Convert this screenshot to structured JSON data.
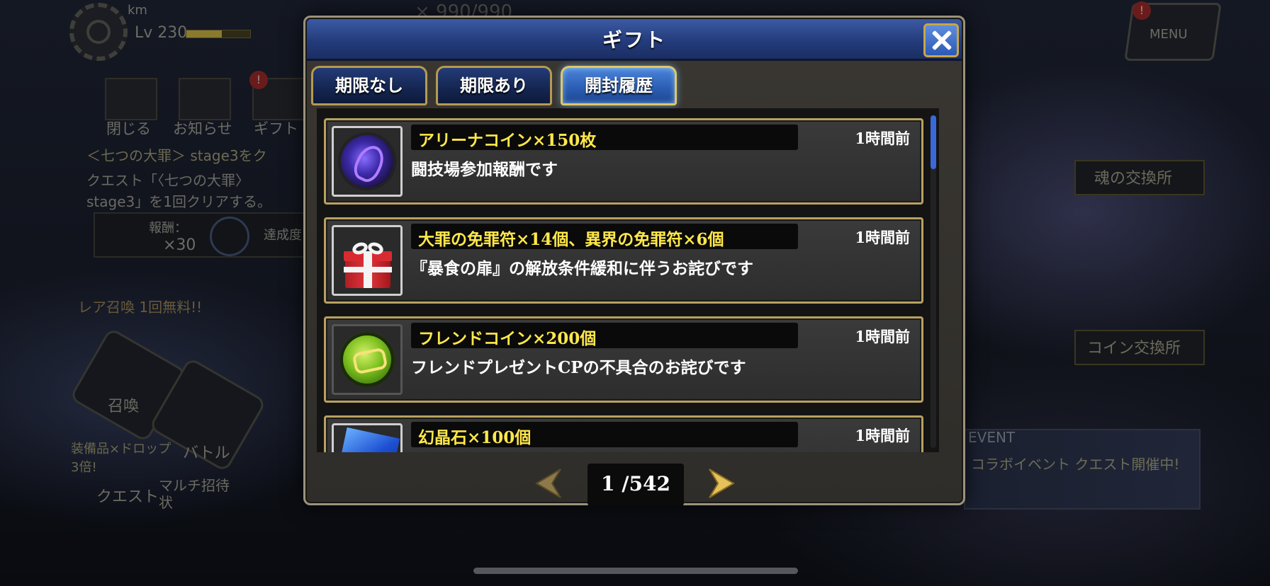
{
  "background": {
    "user_name": "km",
    "user_level": "Lv 230",
    "level_progress": 0.55,
    "stamina_counter": "× 990/990",
    "menu_label": "MENU",
    "quick_buttons": [
      "閉じる",
      "お知らせ",
      "ギフト"
    ],
    "mission_title": "＜七つの大罪＞ stage3をク",
    "mission_body_line1": "クエスト「〈七つの大罪〉",
    "mission_body_line2": "stage3」を1回クリアする。",
    "reward_label": "報酬：",
    "reward_count": "×30",
    "achievement_label": "達成度",
    "banner_text": "レア召喚 1回無料!!",
    "menu_items": [
      "召喚",
      "バトル",
      "クエスト",
      "マルチ招待状"
    ],
    "drop_text": "装備品×ドロップ3倍!",
    "side_buttons": [
      "魂の交換所",
      "コイン交換所"
    ],
    "event_label": "EVENT",
    "event_banner_text": "コラボイベント クエスト開催中!"
  },
  "dialog": {
    "title": "ギフト",
    "tabs": [
      {
        "label": "期限なし",
        "active": false
      },
      {
        "label": "期限あり",
        "active": false
      },
      {
        "label": "開封履歴",
        "active": true
      }
    ],
    "gifts": [
      {
        "icon": "arena-coin-icon",
        "name": "アリーナコイン×150枚",
        "time": "1時間前",
        "description": "闘技場参加報酬です"
      },
      {
        "icon": "gift-box-icon",
        "name": "大罪の免罪符×14個、異界の免罪符×6個",
        "time": "1時間前",
        "description": "『暴食の扉』の解放条件緩和に伴うお詫びです"
      },
      {
        "icon": "friend-coin-icon",
        "name": "フレンドコイン×200個",
        "time": "1時間前",
        "description": "フレンドプレゼントCPの不具合のお詫びです"
      },
      {
        "icon": "crystal-icon",
        "name": "幻晶石×100個",
        "time": "1時間前",
        "description": ""
      }
    ],
    "scroll_position": 0,
    "pager": {
      "current": "1",
      "total": "/542"
    }
  },
  "colors": {
    "header_blue": "#243c7c",
    "gold_border": "#b8a160",
    "item_name_yellow": "#ffe84a",
    "active_tab_blue": "#2b5fb5"
  }
}
